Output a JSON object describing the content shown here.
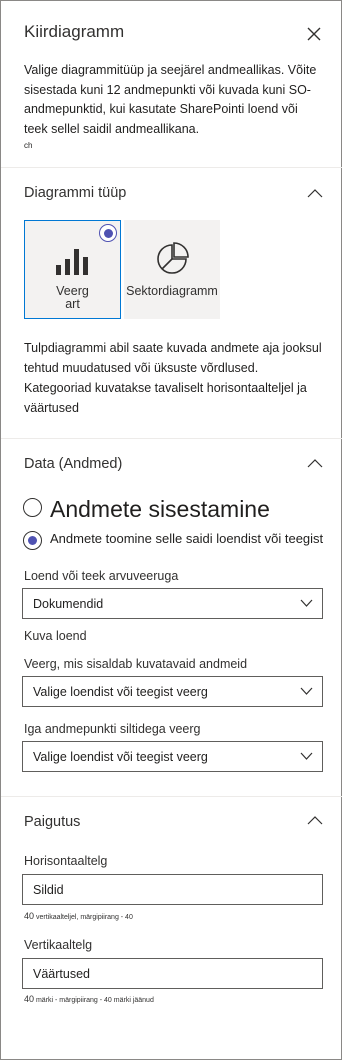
{
  "panel": {
    "title": "Kiirdiagramm",
    "description": "Valige diagrammitüüp ja seejärel andmeallikas. Võite sisestada kuni 12 andmepunkti või kuvada kuni SO-andmepunktid, kui kasutate SharePointi loend või teek sellel saidil andmeallikana.",
    "description_tail": "ch"
  },
  "chart_type": {
    "section_title": "Diagrammi tüüp",
    "options": [
      {
        "label_line1": "Veerg",
        "label_line2": "art",
        "icon": "bar-chart-icon",
        "selected": true
      },
      {
        "label": "Sektordiagramm",
        "icon": "pie-chart-icon",
        "selected": false
      }
    ],
    "info": "Tulpdiagrammi abil saate kuvada andmete aja jooksul tehtud muudatused või üksuste võrdlused. Kategooriad kuvatakse tavaliselt horisontaalteljel ja väärtused"
  },
  "data": {
    "section_title": "Data (Andmed)",
    "radio_manual": "Andmete sisestamine",
    "radio_list": "Andmete toomine selle saidi loendist või teegist",
    "list_label": "Loend või teek arvuveeruga",
    "list_value": "Dokumendid",
    "show_list": "Kuva loend",
    "column_label": "Veerg, mis sisaldab kuvatavaid andmeid",
    "column_value": "Valige loendist või teegist veerg",
    "label_column_label": "Iga andmepunkti siltidega veerg",
    "label_column_value": "Valige loendist või teegist veerg"
  },
  "layout_section": {
    "section_title": "Paigutus",
    "horizontal_label": "Horisontaaltelg",
    "horizontal_value": "Sildid",
    "horizontal_counter_num": "40",
    "horizontal_counter_text": "vertikaalteljel, märgipiirang - 40",
    "vertical_label": "Vertikaaltelg",
    "vertical_value": "Väärtused",
    "vertical_counter_num": "40",
    "vertical_counter_text": "märki - märgipiirang - 40 märki jäänud"
  },
  "colors": {
    "accent": "#4f52b2",
    "selected_border": "#0078d4",
    "card_bg": "#f3f2f1",
    "divider": "#edebe9"
  }
}
